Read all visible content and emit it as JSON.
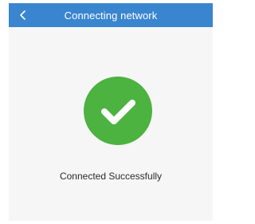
{
  "header": {
    "title": "Connecting network",
    "background_color": "#3a85cf",
    "back_icon": "chevron-left-icon"
  },
  "main": {
    "status_icon": "check-circle-icon",
    "status_icon_color": "#4cb240",
    "status_text": "Connected Successfully"
  }
}
